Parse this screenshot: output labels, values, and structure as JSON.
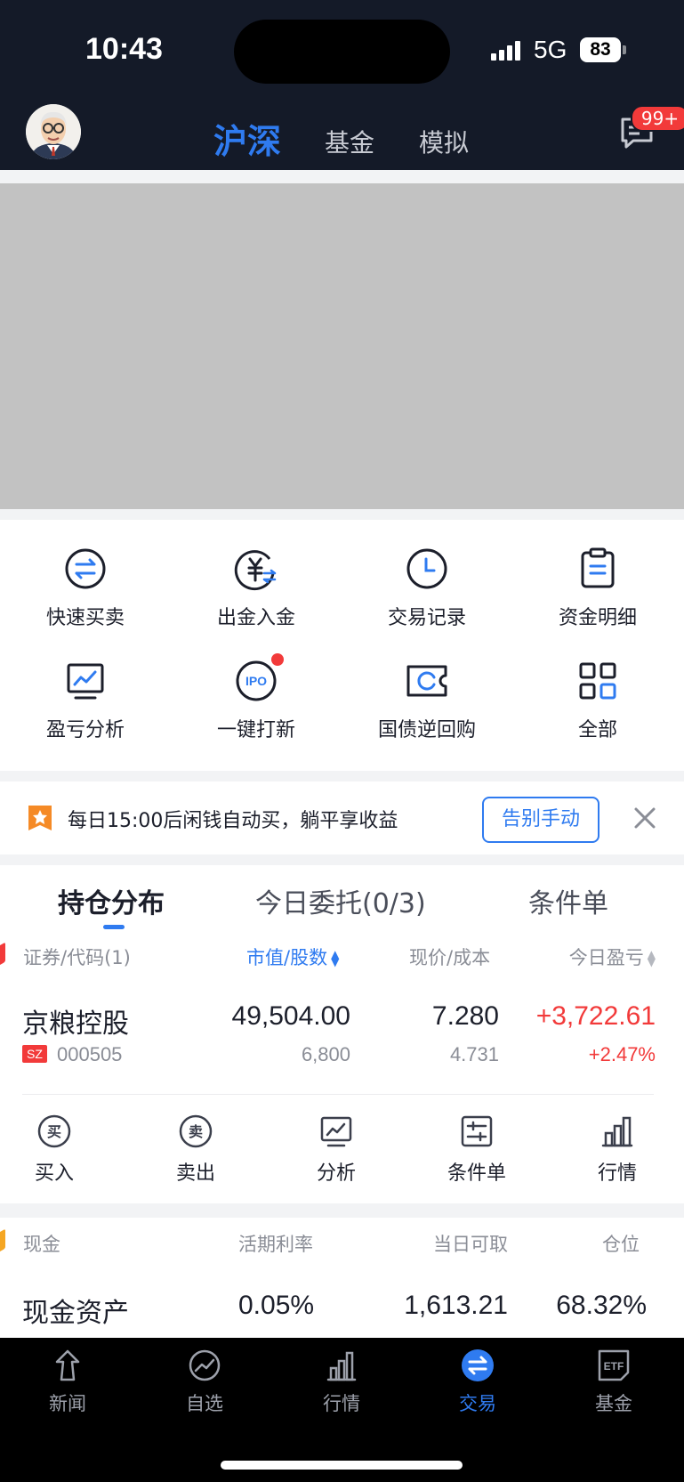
{
  "status_bar": {
    "time": "10:43",
    "network": "5G",
    "battery": "83"
  },
  "header": {
    "tabs": [
      {
        "label": "沪深",
        "active": true
      },
      {
        "label": "基金"
      },
      {
        "label": "模拟"
      }
    ],
    "message_badge": "99+"
  },
  "quick_actions": [
    {
      "label": "快速买卖",
      "icon": "swap-icon"
    },
    {
      "label": "出金入金",
      "icon": "yen-transfer-icon"
    },
    {
      "label": "交易记录",
      "icon": "clock-icon"
    },
    {
      "label": "资金明细",
      "icon": "clipboard-icon"
    },
    {
      "label": "盈亏分析",
      "icon": "monitor-chart-icon"
    },
    {
      "label": "一键打新",
      "icon": "ipo-icon",
      "has_dot": true
    },
    {
      "label": "国债逆回购",
      "icon": "ticket-icon"
    },
    {
      "label": "全部",
      "icon": "grid-icon"
    }
  ],
  "ipo_icon_text": "IPO",
  "promo": {
    "text": "每日15:00后闲钱自动买，躺平享收益",
    "button": "告别手动"
  },
  "holdings": {
    "tabs": [
      "持仓分布",
      "今日委托(0/3)",
      "条件单"
    ],
    "headers": [
      "证券/代码(1)",
      "市值/股数",
      "现价/成本",
      "今日盈亏"
    ],
    "row": {
      "name": "京粮控股",
      "market": "SZ",
      "code": "000505",
      "market_value": "49,504.00",
      "shares": "6,800",
      "price": "7.280",
      "cost": "4.731",
      "pnl": "+3,722.61",
      "pnl_pct": "+2.47%"
    },
    "actions": [
      {
        "label": "买入",
        "glyph": "买"
      },
      {
        "label": "卖出",
        "glyph": "卖"
      },
      {
        "label": "分析"
      },
      {
        "label": "条件单"
      },
      {
        "label": "行情"
      }
    ]
  },
  "cash": {
    "headers": [
      "现金",
      "活期利率",
      "当日可取",
      "仓位"
    ],
    "values": [
      "现金资产",
      "0.05%",
      "1,613.21",
      "68.32%"
    ]
  },
  "tabbar": [
    {
      "label": "新闻"
    },
    {
      "label": "自选"
    },
    {
      "label": "行情"
    },
    {
      "label": "交易",
      "active": true
    },
    {
      "label": "基金",
      "glyph": "ETF"
    }
  ],
  "colors": {
    "accent": "#2f7bf0",
    "up": "#f23a3a",
    "header_bg": "#141a28"
  }
}
